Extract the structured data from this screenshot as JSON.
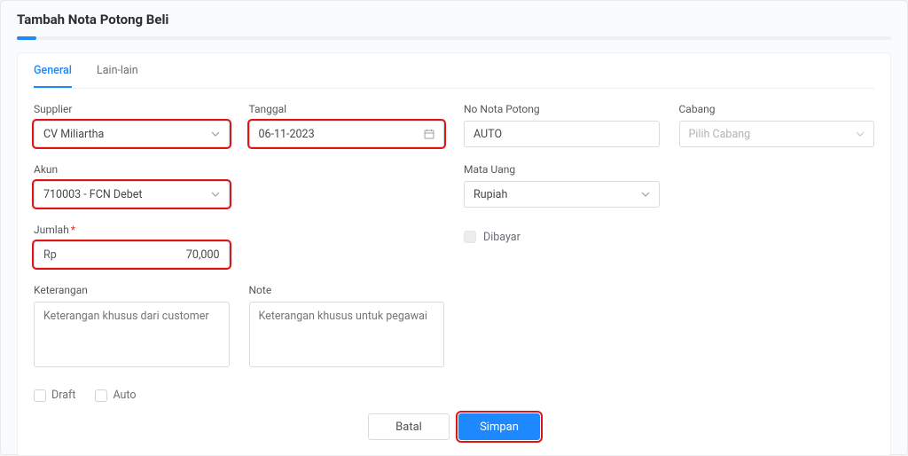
{
  "page_title": "Tambah Nota Potong Beli",
  "tabs": {
    "general": "General",
    "lain": "Lain-lain"
  },
  "labels": {
    "supplier": "Supplier",
    "tanggal": "Tanggal",
    "no_nota": "No Nota Potong",
    "cabang": "Cabang",
    "akun": "Akun",
    "mata_uang": "Mata Uang",
    "jumlah": "Jumlah",
    "dibayar": "Dibayar",
    "keterangan": "Keterangan",
    "note": "Note",
    "draft": "Draft",
    "auto": "Auto"
  },
  "values": {
    "supplier": "CV Miliartha",
    "tanggal": "06-11-2023",
    "no_nota": "AUTO",
    "cabang_placeholder": "Pilih Cabang",
    "akun": "710003 - FCN Debet",
    "mata_uang": "Rupiah",
    "jumlah_prefix": "Rp",
    "jumlah": "70,000",
    "keterangan_placeholder": "Keterangan khusus dari customer",
    "note_placeholder": "Keterangan khusus untuk pegawai"
  },
  "buttons": {
    "batal": "Batal",
    "simpan": "Simpan"
  }
}
